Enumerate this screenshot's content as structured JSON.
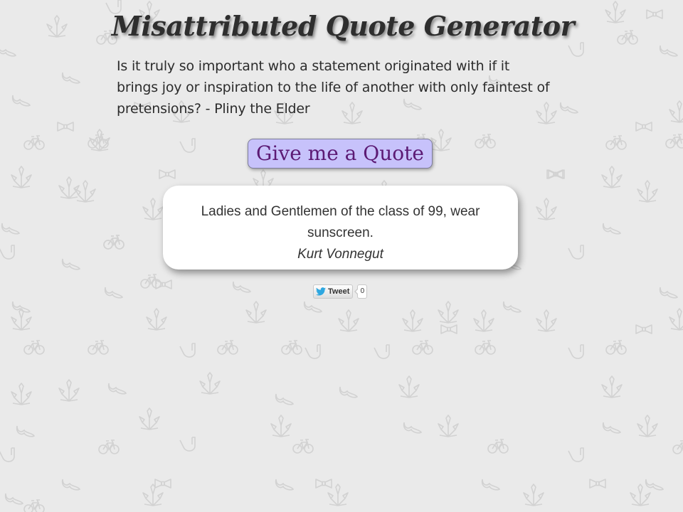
{
  "page": {
    "title": "Misattributed Quote Generator",
    "intro": "Is it truly so important who a statement originated with if it brings joy or inspiration to the life of another with only faintest of pretensions? - Pliny the Elder"
  },
  "button": {
    "label": "Give me a Quote"
  },
  "quote": {
    "text": "Ladies and Gentlemen of the class of 99, wear sunscreen.",
    "author": "Kurt Vonnegut"
  },
  "tweet": {
    "label": "Tweet",
    "count": "0",
    "icon": "twitter-bird-icon"
  },
  "background": {
    "pattern_icons": [
      "leaf-icon",
      "bicycle-icon",
      "mustache-icon",
      "bowtie-icon",
      "pipe-icon"
    ]
  },
  "colors": {
    "background": "#eaeaea",
    "button_fill": "#c7c2fb",
    "button_text": "#5c1a74",
    "card": "#ffffff",
    "pattern": "#d3d3d3"
  }
}
